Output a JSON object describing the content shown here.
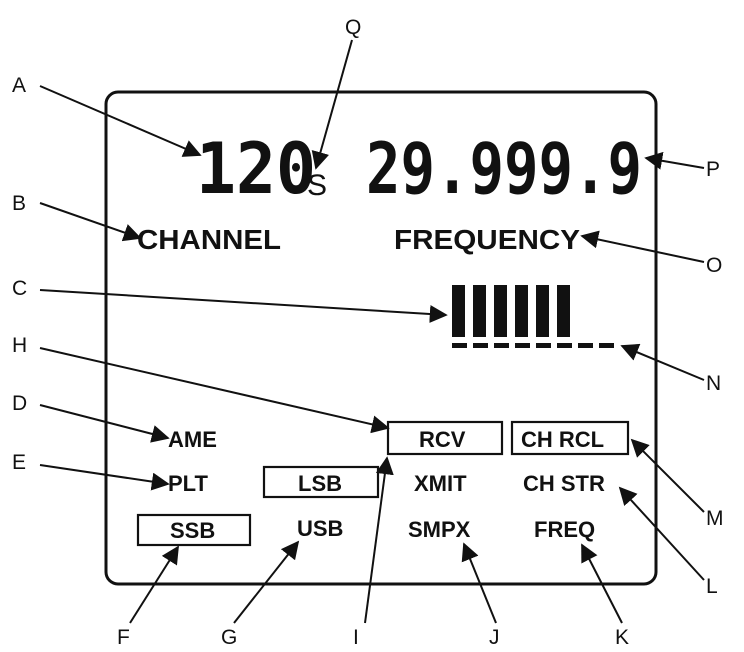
{
  "display": {
    "channel_digits": "120",
    "scan_indicator": "S",
    "frequency_digits": "29.999.9",
    "channel_label": "CHANNEL",
    "frequency_label": "FREQUENCY",
    "signal_bars_lit": 6,
    "signal_bars_total": 8
  },
  "modes": {
    "ame": "AME",
    "plt": "PLT",
    "ssb": "SSB",
    "lsb": "LSB",
    "usb": "USB",
    "rcv": "RCV",
    "xmit": "XMIT",
    "smpx": "SMPX",
    "ch_rcl": "CH RCL",
    "ch_str": "CH STR",
    "freq": "FREQ"
  },
  "callouts": {
    "a": "A",
    "b": "B",
    "c": "C",
    "d": "D",
    "e": "E",
    "f": "F",
    "g": "G",
    "h": "H",
    "i": "I",
    "j": "J",
    "k": "K",
    "l": "L",
    "m": "M",
    "n": "N",
    "o": "O",
    "p": "P",
    "q": "Q"
  }
}
